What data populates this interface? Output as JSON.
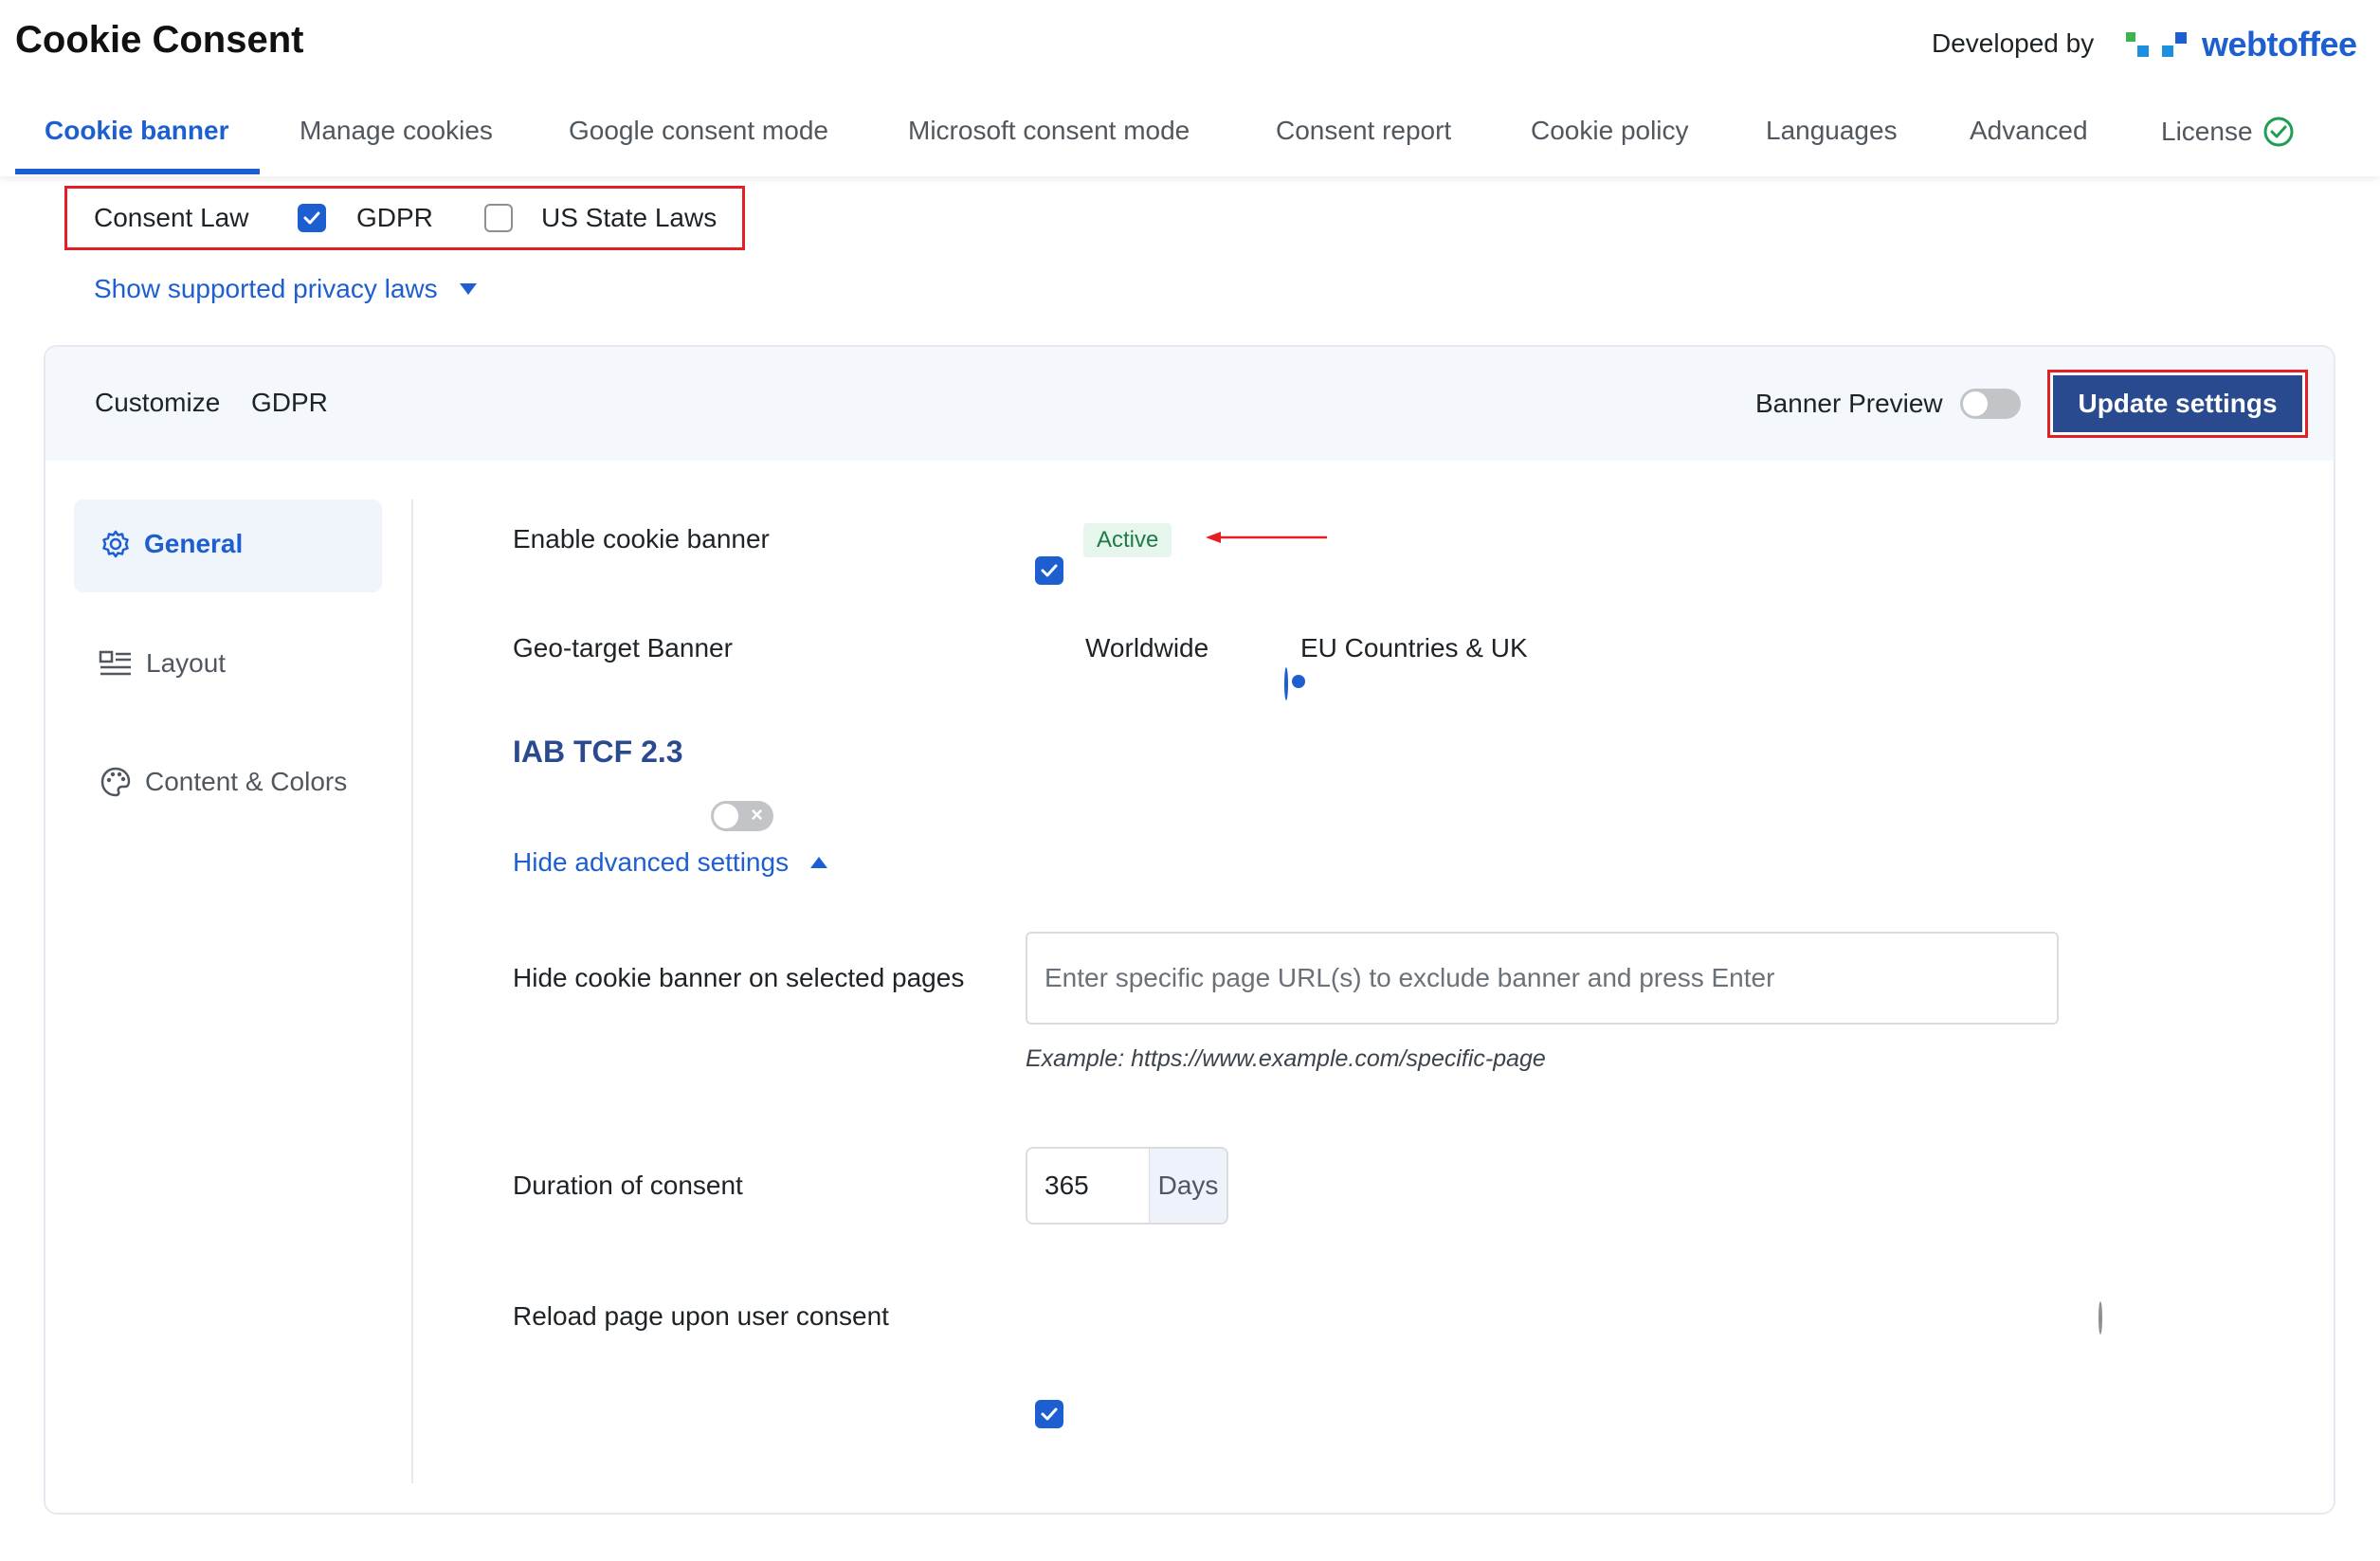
{
  "app": {
    "title": "Cookie Consent",
    "developed_by": "Developed by",
    "brand": "webtoffee"
  },
  "tabs": [
    {
      "label": "Cookie banner",
      "active": true
    },
    {
      "label": "Manage cookies"
    },
    {
      "label": "Google consent mode"
    },
    {
      "label": "Microsoft consent mode"
    },
    {
      "label": "Consent report"
    },
    {
      "label": "Cookie policy"
    },
    {
      "label": "Languages"
    },
    {
      "label": "Advanced"
    },
    {
      "label": "License"
    }
  ],
  "consent_law": {
    "label": "Consent Law",
    "options": [
      {
        "label": "GDPR",
        "checked": true
      },
      {
        "label": "US State Laws",
        "checked": false
      }
    ],
    "show_laws_link": "Show supported privacy laws"
  },
  "customize": {
    "label": "Customize",
    "law": "GDPR",
    "banner_preview_label": "Banner Preview",
    "update_button": "Update settings"
  },
  "sidebar": {
    "items": [
      {
        "label": "General",
        "icon": "gear-icon",
        "active": true
      },
      {
        "label": "Layout",
        "icon": "layout-icon"
      },
      {
        "label": "Content & Colors",
        "icon": "palette-icon"
      }
    ]
  },
  "settings": {
    "enable_banner": {
      "label": "Enable cookie banner",
      "checked": true,
      "status": "Active"
    },
    "geo_target": {
      "label": "Geo-target Banner",
      "options": [
        {
          "label": "Worldwide",
          "selected": false
        },
        {
          "label": "EU Countries & UK",
          "selected": true
        }
      ]
    },
    "iab": {
      "label": "IAB TCF 2.3",
      "enabled": false
    },
    "advanced_link": "Hide advanced settings",
    "hide_pages": {
      "label": "Hide cookie banner on selected pages",
      "placeholder": "Enter specific page URL(s) to exclude banner and press Enter",
      "value": "",
      "example": "Example: https://www.example.com/specific-page"
    },
    "duration": {
      "label": "Duration of consent",
      "value": "365",
      "unit": "Days"
    },
    "reload": {
      "label": "Reload page upon user consent",
      "checked": true
    }
  },
  "colors": {
    "accent": "#1d5fd1",
    "primary_button": "#2a4a8f",
    "highlight_border": "#e31e24",
    "active_badge_bg": "#e6f6ec",
    "license_check": "#1f9d55"
  }
}
